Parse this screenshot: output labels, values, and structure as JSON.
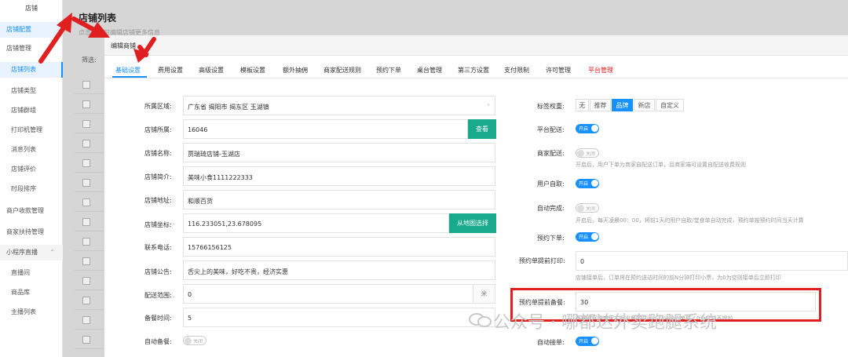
{
  "sidebar": {
    "logo": "店铺",
    "items": [
      {
        "label": "店铺配置"
      },
      {
        "label": "店铺管理"
      },
      {
        "label": "店铺列表"
      },
      {
        "label": "店铺类型"
      },
      {
        "label": "店铺群组"
      },
      {
        "label": "打印机管理"
      },
      {
        "label": "消息列表"
      },
      {
        "label": "店铺评价"
      },
      {
        "label": "时段排序"
      },
      {
        "label": "商户收款管理"
      },
      {
        "label": "商家扶持管理"
      },
      {
        "label": "小程序直播"
      },
      {
        "label": "直播间"
      },
      {
        "label": "商品库"
      },
      {
        "label": "主播列表"
      }
    ]
  },
  "page": {
    "title": "店铺列表",
    "subtitle": "点击编辑可编辑店铺更多信息",
    "filter_label": "筛选:"
  },
  "modal": {
    "title": "编辑商铺",
    "tabs": [
      {
        "label": "基础设置"
      },
      {
        "label": "费用设置"
      },
      {
        "label": "高级设置"
      },
      {
        "label": "模板设置"
      },
      {
        "label": "额外抽佣"
      },
      {
        "label": "商家配送规则"
      },
      {
        "label": "预约下单"
      },
      {
        "label": "桌台管理"
      },
      {
        "label": "第三方设置"
      },
      {
        "label": "支付限制"
      },
      {
        "label": "许可管理"
      },
      {
        "label": "平台管理"
      }
    ],
    "left": {
      "region": {
        "label": "所属区域:",
        "value": "广东省 揭阳市 揭东区 玉湖镇"
      },
      "owner": {
        "label": "店铺所属:",
        "value": "16046",
        "button": "查看"
      },
      "name": {
        "label": "店铺名称:",
        "value": "贾瑞琦店铺-玉湖店"
      },
      "intro": {
        "label": "店铺简介:",
        "value": "美味小食1111222333"
      },
      "address": {
        "label": "店铺地址:",
        "value": "和顺百货"
      },
      "coords": {
        "label": "店铺坐标:",
        "value": "116.233051,23.678095",
        "button": "从地图选择"
      },
      "phone": {
        "label": "联系电话:",
        "value": "15766156125"
      },
      "notice": {
        "label": "店铺公告:",
        "value": "舌尖上的美味，好吃不贵，经济实惠"
      },
      "range": {
        "label": "配送范围:",
        "value": "0",
        "unit": "米"
      },
      "prep_time": {
        "label": "备餐时间:",
        "value": "5"
      },
      "auto_prep": {
        "label": "自动备餐:",
        "toggle": "关闭"
      }
    },
    "right": {
      "tag_weight": {
        "label": "标签权重:",
        "options": [
          "无",
          "推荐",
          "品牌",
          "新店",
          "自定义"
        ],
        "selected": "品牌"
      },
      "platform_delivery": {
        "label": "平台配送:",
        "toggle": "开启"
      },
      "merchant_delivery": {
        "label": "商家配送:",
        "toggle": "关闭",
        "hint": "开启后，用户下单为商家自配送订单，且商家端可设置自配送收费规则"
      },
      "self_pickup": {
        "label": "用户自取:",
        "toggle": "开启"
      },
      "auto_complete": {
        "label": "自动完成:",
        "toggle": "关闭",
        "hint": "开启后，每天凌晨00：00，将前1天的用户自取/堂食单自动完成，预约单按预约时间当天计算"
      },
      "reserve": {
        "label": "预约下单:",
        "toggle": "开启"
      },
      "reserve_print": {
        "label": "预约单提前打印:",
        "value": "0",
        "hint": "店铺接单后，订单将在预约送达时间的前N分钟打印小票，为0为空则接单后立即打印"
      },
      "reserve_prep": {
        "label": "预约单提前备餐:",
        "value": "30",
        "hint": "备餐时间是商家实际出餐的时间，以分钟为单位，0为空则不提前"
      },
      "auto_accept": {
        "label": "自动接单:",
        "toggle": "开启"
      }
    }
  },
  "watermark": "公众号 · 哪都达外卖跑腿系统",
  "colors": {
    "accent": "#1890ff",
    "green": "#19a98c",
    "red": "#e02020"
  }
}
